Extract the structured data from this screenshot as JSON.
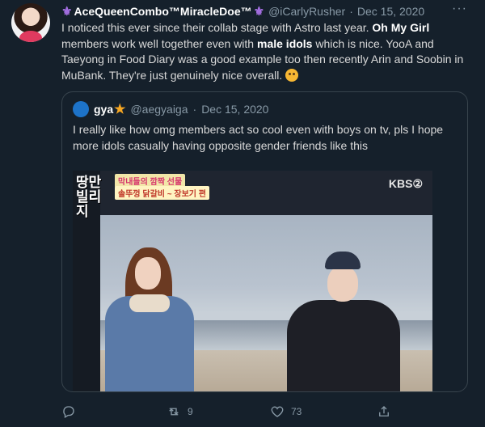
{
  "tweet": {
    "display_name": "AceQueenCombo™MiracleDoe™",
    "handle": "@iCarlyRusher",
    "separator": "·",
    "date": "Dec 15, 2020",
    "more_label": "···",
    "text_parts": [
      "I noticed this ever since their collab stage with Astro last year. ",
      "Oh My Girl",
      " members work well together even with ",
      "male idols",
      " which is nice. YooA and Taeyong in Food Diary was a good example too then recently Arin and Soobin in MuBank. They're just genuinely nice overall. "
    ]
  },
  "quote": {
    "display_name": "gya",
    "handle": "@aegyaiga",
    "separator": "·",
    "date": "Dec 15, 2020",
    "text": "I really like how omg members act so cool even with boys on tv, pls I hope more idols casually having opposite gender friends like this",
    "media": {
      "show_logo": "땅만 빌리지",
      "caption_line1": "막내들의 깜짝 선물",
      "caption_line2": "솔뚜껑 닭갈비 ~ 장보기 편",
      "broadcaster": "KBS②"
    }
  },
  "actions": {
    "reply_count": "",
    "retweet_count": "9",
    "like_count": "73",
    "share_count": ""
  },
  "colors": {
    "background": "#15202b",
    "border": "#38444d",
    "muted": "#8899a6",
    "accent_purple": "#a36ee0"
  }
}
